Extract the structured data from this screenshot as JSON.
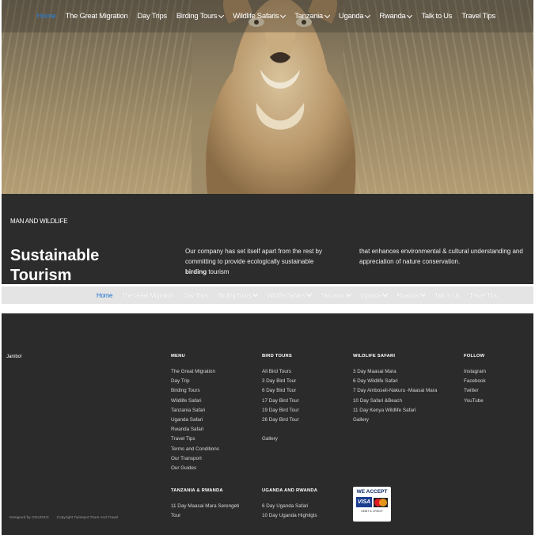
{
  "nav": {
    "items": [
      {
        "label": "Home",
        "active": true,
        "dropdown": false
      },
      {
        "label": "The Great Migration",
        "dropdown": false
      },
      {
        "label": "Day Trips",
        "dropdown": false
      },
      {
        "label": "Birding Tours",
        "dropdown": true
      },
      {
        "label": "Wildlife Safaris",
        "dropdown": true
      },
      {
        "label": "Tanzania",
        "dropdown": true
      },
      {
        "label": "Uganda",
        "dropdown": true
      },
      {
        "label": "Rwanda",
        "dropdown": true
      },
      {
        "label": "Talk to Us",
        "dropdown": false
      },
      {
        "label": "Travel Tips",
        "dropdown": false
      }
    ]
  },
  "intro": {
    "kicker": "MAN AND WILDLIFE",
    "title": "Sustainable Tourism",
    "col_a_1": "Our company has set itself apart from the rest by committing to provide ecologically sustainable ",
    "col_a_bold": "birding",
    "col_a_2": " tourism",
    "col_b": "that enhances environmental & cultural understanding and appreciation of nature conservation."
  },
  "footer": {
    "brand": "Jambo!",
    "menu": {
      "heading": "MENU",
      "links": [
        "The Great Migration",
        "Day Trip",
        "Birding Tours",
        "Wildlife Safari",
        "Tanzania Safari",
        "Uganda Safari",
        "Rwanda Safari",
        "Travel Tips",
        "Terms and Conditions",
        "Our Transport",
        "Our Guides"
      ]
    },
    "bird_tours": {
      "heading": "BIRD TOURS",
      "links": [
        "All Bird Tours",
        "3 Day Bird Tour",
        "6 Day Bird Tour",
        "17 Day Bird Tour",
        "19 Day Bird Tour",
        "26 Day Bird Tour"
      ],
      "gallery": "Gallery"
    },
    "wildlife_safari": {
      "heading": "WILDLIFE SAFARI",
      "links": [
        "3 Day Maasai Mara",
        "6 Day Wildlife Safari",
        "7 Day Amboseli-Nakuru -Maasai Mara",
        "10 Day Safari &Beach",
        "11 Day Kenya Wildlife Safari",
        "Gallery"
      ]
    },
    "follow": {
      "heading": "FOLLOW",
      "links": [
        "Instagram",
        "Facebook",
        "Twitter",
        "YouTube"
      ]
    },
    "tanzania_rwanda": {
      "heading": "TANZANIA & RWANDA",
      "links": [
        "11 Day Maasai Mara Serengeti Tour"
      ]
    },
    "uganda_rwanda": {
      "heading": "UGANDA AND RWANDA",
      "links": [
        "6 Day Uganda Safari",
        "10 Day Uganda Highligts"
      ]
    },
    "accept": {
      "title": "WE ACCEPT",
      "visa": "VISA",
      "sub": "DEBIT & CREDIT"
    },
    "credits": {
      "designed": "Designed by OGUOKO",
      "copyright": "Copyright Twinspot Tours And Travel"
    }
  },
  "colors": {
    "accent": "#2a7fd6",
    "dark_bg": "#2c2c2c",
    "sticky_bg": "#e4e4e4"
  }
}
